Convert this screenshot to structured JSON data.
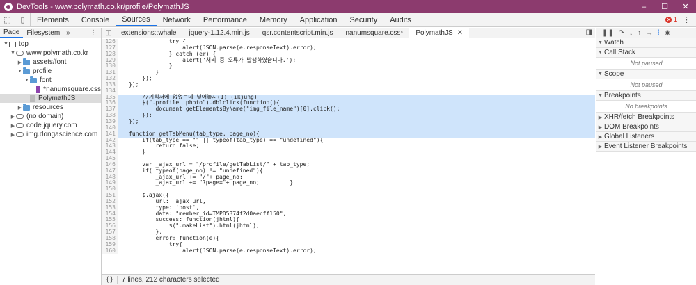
{
  "window": {
    "title": "DevTools - www.polymath.co.kr/profile/PolymathJS",
    "minimize": "–",
    "maximize": "☐",
    "close": "✕"
  },
  "main_tabs": {
    "items": [
      "Elements",
      "Console",
      "Sources",
      "Network",
      "Performance",
      "Memory",
      "Application",
      "Security",
      "Audits"
    ],
    "active": "Sources",
    "error_count": "1"
  },
  "navigator": {
    "tabs": [
      "Page",
      "Filesystem"
    ],
    "more": "»",
    "kebab": "⋮",
    "tree": [
      {
        "label": "top",
        "depth": 0,
        "arrow": "▼",
        "icon": "frame"
      },
      {
        "label": "www.polymath.co.kr",
        "depth": 1,
        "arrow": "▼",
        "icon": "cloud"
      },
      {
        "label": "assets/font",
        "depth": 2,
        "arrow": "▶",
        "icon": "folder"
      },
      {
        "label": "profile",
        "depth": 2,
        "arrow": "▼",
        "icon": "folder"
      },
      {
        "label": "font",
        "depth": 3,
        "arrow": "▼",
        "icon": "folder"
      },
      {
        "label": "*nanumsquare.css",
        "depth": 4,
        "arrow": "",
        "icon": "css"
      },
      {
        "label": "PolymathJS",
        "depth": 3,
        "arrow": "",
        "icon": "doc",
        "selected": true
      },
      {
        "label": "resources",
        "depth": 2,
        "arrow": "▶",
        "icon": "folder"
      },
      {
        "label": "(no domain)",
        "depth": 1,
        "arrow": "▶",
        "icon": "cloud"
      },
      {
        "label": "code.jquery.com",
        "depth": 1,
        "arrow": "▶",
        "icon": "cloud"
      },
      {
        "label": "img.dongascience.com",
        "depth": 1,
        "arrow": "▶",
        "icon": "cloud"
      }
    ]
  },
  "editor": {
    "tabs": [
      "extensions::whale",
      "jquery-1.12.4.min.js",
      "qsr.contentscript.min.js",
      "nanumsquare.css*",
      "PolymathJS"
    ],
    "active_tab": "PolymathJS",
    "lines": [
      {
        "n": "126",
        "t": "            try {"
      },
      {
        "n": "127",
        "t": "                alert(JSON.parse(e.responseText).error);"
      },
      {
        "n": "128",
        "t": "            } catch (er) {"
      },
      {
        "n": "129",
        "t": "                alert('처리 중 오류가 발생하였습니다.');"
      },
      {
        "n": "130",
        "t": "            }"
      },
      {
        "n": "131",
        "t": "        }"
      },
      {
        "n": "132",
        "t": "    });"
      },
      {
        "n": "133",
        "t": "});"
      },
      {
        "n": "134",
        "t": ""
      },
      {
        "n": "135",
        "t": "    //기획서에 없었는데 넣어놓지(1) (ikjung)",
        "sel": true
      },
      {
        "n": "136",
        "t": "    $(\".profile .photo\").dblclick(function(){",
        "sel": true
      },
      {
        "n": "137",
        "t": "        document.getElementsByName(\"img_file_name\")[0].click();",
        "sel": true
      },
      {
        "n": "138",
        "t": "    });",
        "sel": true
      },
      {
        "n": "139",
        "t": "});",
        "sel": true
      },
      {
        "n": "140",
        "t": "",
        "sel": true
      },
      {
        "n": "141",
        "t": "function getTabMenu(tab_type, page_no){",
        "sel": true
      },
      {
        "n": "142",
        "t": "    if(tab_type == \"\" || typeof(tab_type) == \"undefined\"){"
      },
      {
        "n": "143",
        "t": "        return false;"
      },
      {
        "n": "144",
        "t": "    }"
      },
      {
        "n": "145",
        "t": ""
      },
      {
        "n": "146",
        "t": "    var _ajax_url = \"/profile/getTabList/\" + tab_type;"
      },
      {
        "n": "147",
        "t": "    if( typeof(page_no) != \"undefined\"){"
      },
      {
        "n": "148",
        "t": "        _ajax_url += \"/\"+ page_no;"
      },
      {
        "n": "149",
        "t": "        _ajax_url += \"?page=\"+ page_no;         }"
      },
      {
        "n": "150",
        "t": ""
      },
      {
        "n": "151",
        "t": "    $.ajax({"
      },
      {
        "n": "152",
        "t": "        url: _ajax_url,"
      },
      {
        "n": "153",
        "t": "        type: 'post',"
      },
      {
        "n": "154",
        "t": "        data: \"member_id=TMPD5374f2d0aecff150\","
      },
      {
        "n": "155",
        "t": "        success: function(jhtml){"
      },
      {
        "n": "156",
        "t": "            $(\".makeList\").html(jhtml);"
      },
      {
        "n": "157",
        "t": "        },"
      },
      {
        "n": "158",
        "t": "        error: function(e){"
      },
      {
        "n": "159",
        "t": "            try{"
      },
      {
        "n": "160",
        "t": "                alert(JSON.parse(e.responseText).error);"
      }
    ],
    "status": "7 lines, 212 characters selected",
    "braces": "{}"
  },
  "debugger": {
    "sections": [
      {
        "title": "Watch",
        "open": true,
        "body": ""
      },
      {
        "title": "Call Stack",
        "open": true,
        "body": "Not paused"
      },
      {
        "title": "Scope",
        "open": true,
        "body": "Not paused"
      },
      {
        "title": "Breakpoints",
        "open": true,
        "body": "No breakpoints"
      },
      {
        "title": "XHR/fetch Breakpoints",
        "open": false,
        "body": ""
      },
      {
        "title": "DOM Breakpoints",
        "open": false,
        "body": ""
      },
      {
        "title": "Global Listeners",
        "open": false,
        "body": ""
      },
      {
        "title": "Event Listener Breakpoints",
        "open": false,
        "body": ""
      }
    ]
  }
}
